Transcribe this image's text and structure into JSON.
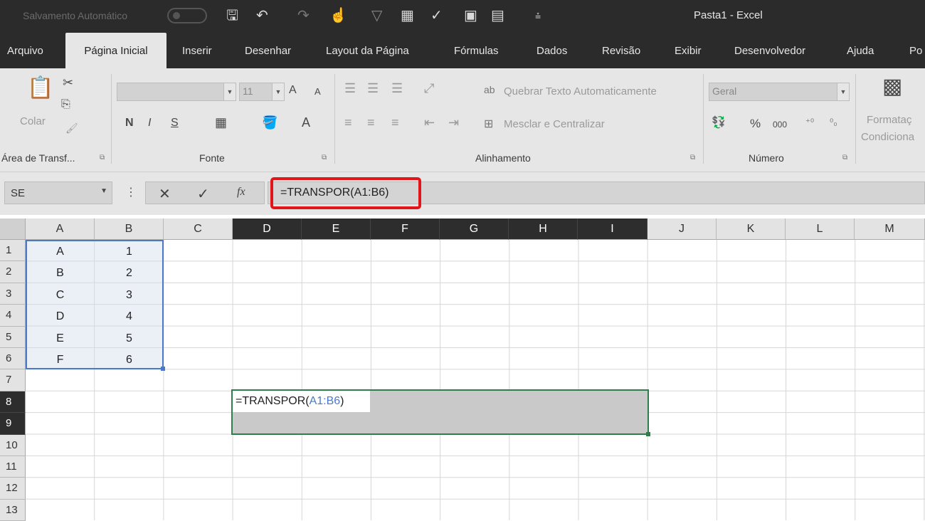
{
  "titlebar": {
    "autosave_label": "Salvamento Automático",
    "doc_title": "Pasta1  -  Excel"
  },
  "tabs": [
    "Arquivo",
    "Página Inicial",
    "Inserir",
    "Desenhar",
    "Layout da Página",
    "Fórmulas",
    "Dados",
    "Revisão",
    "Exibir",
    "Desenvolvedor",
    "Ajuda",
    "Po"
  ],
  "active_tab": "Página Inicial",
  "ribbon": {
    "clipboard": {
      "paste_label": "Colar",
      "group_label": "Área de Transf..."
    },
    "font": {
      "font_size": "11",
      "bold": "N",
      "italic": "I",
      "underline": "S",
      "group_label": "Fonte",
      "grow": "A",
      "shrink": "A",
      "color": "A"
    },
    "alignment": {
      "wrap_text": "Quebrar Texto Automaticamente",
      "merge_center": "Mesclar e Centralizar",
      "group_label": "Alinhamento"
    },
    "number": {
      "format": "Geral",
      "percent": "%",
      "thousands": "000",
      "group_label": "Número"
    },
    "styles": {
      "conditional_line1": "Formataç",
      "conditional_line2": "Condiciona"
    }
  },
  "formula_bar": {
    "name_box": "SE",
    "formula": "=TRANSPOR(A1:B6)"
  },
  "columns": [
    "A",
    "B",
    "C",
    "D",
    "E",
    "F",
    "G",
    "H",
    "I",
    "J",
    "K",
    "L",
    "M"
  ],
  "rows": [
    "1",
    "2",
    "3",
    "4",
    "5",
    "6",
    "7",
    "8",
    "9",
    "10",
    "11",
    "12",
    "13"
  ],
  "data": {
    "colA": [
      "A",
      "B",
      "C",
      "D",
      "E",
      "F"
    ],
    "colB": [
      "1",
      "2",
      "3",
      "4",
      "5",
      "6"
    ]
  },
  "edit": {
    "func": "=TRANSPOR(",
    "ref": "A1:B6",
    "close": ")"
  },
  "colors": {
    "highlight": "#e0161b",
    "ref_blue": "#4a7ac7",
    "selection_green": "#2e7d4a"
  }
}
